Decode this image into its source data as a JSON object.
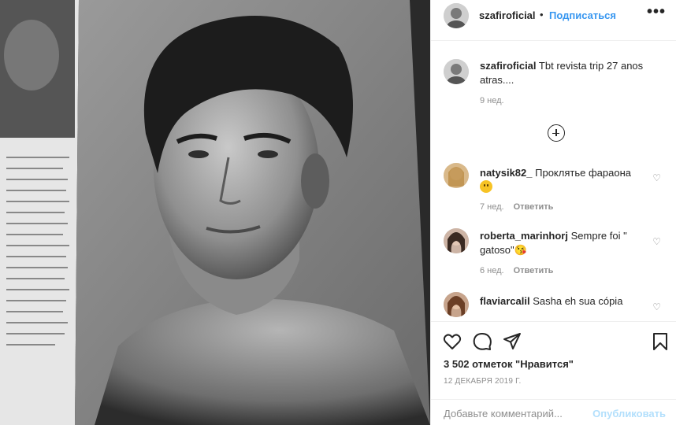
{
  "post": {
    "username": "szafiroficial",
    "dot": "•",
    "follow_label": "Подписаться",
    "more_label": "•••",
    "caption": {
      "username": "szafiroficial",
      "text": "Tbt revista trip 27 anos atras....",
      "time": "9 нед."
    },
    "comments": [
      {
        "username": "natysik82_",
        "text": "Проклятье фараона",
        "has_emoji": true,
        "time": "7 нед.",
        "reply_label": "Ответить"
      },
      {
        "username": "roberta_marinhorj",
        "text": "Sempre foi \" gatoso\"😘",
        "time": "6 нед.",
        "reply_label": "Ответить"
      },
      {
        "username": "flaviarcalil",
        "text": "Sasha eh sua cópia",
        "time": "",
        "reply_label": ""
      }
    ],
    "likes": "3 502 отметок \"Нравится\"",
    "date": "12 ДЕКАБРЯ 2019 Г.",
    "add_comment_placeholder": "Добавьте комментарий...",
    "publish_label": "Опубликовать"
  },
  "icons": {
    "load_more": "plus-circle-icon",
    "like": "heart-icon",
    "comment": "comment-icon",
    "share": "share-icon",
    "save": "bookmark-icon",
    "comment_like": "small-heart-icon"
  },
  "colors": {
    "accent": "#3897f0",
    "publish_disabled": "#b2dffc",
    "muted": "#8e8e8e",
    "text": "#262626"
  }
}
